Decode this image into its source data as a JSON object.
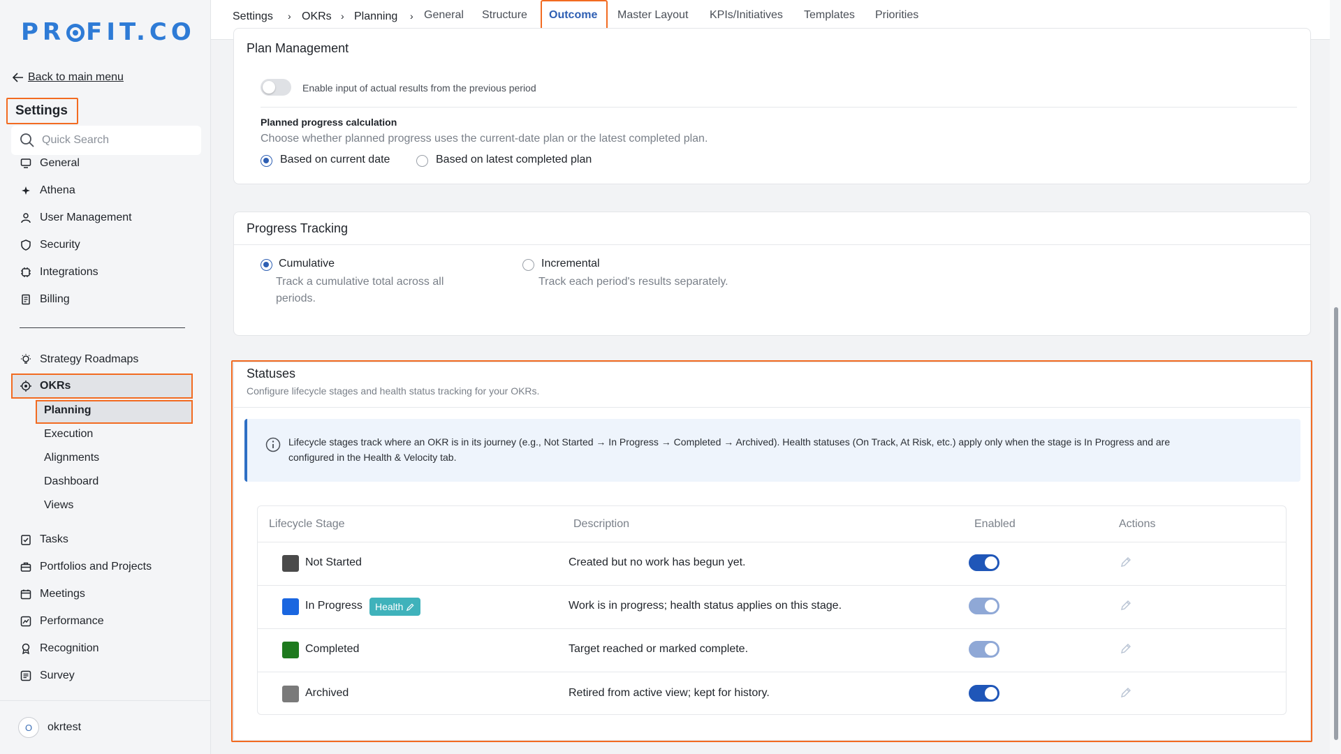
{
  "brand": {
    "logo_text_a": "PR",
    "logo_text_b": "FIT.CO"
  },
  "sidebar": {
    "back_label": "Back to main menu",
    "settings_title": "Settings",
    "search_placeholder": "Quick Search",
    "items": [
      {
        "label": "General",
        "icon": "monitor-icon"
      },
      {
        "label": "Athena",
        "icon": "sparkle-icon"
      },
      {
        "label": "User Management",
        "icon": "user-icon"
      },
      {
        "label": "Security",
        "icon": "shield-icon"
      },
      {
        "label": "Integrations",
        "icon": "chip-icon"
      },
      {
        "label": "Billing",
        "icon": "receipt-icon"
      }
    ],
    "modules": [
      {
        "label": "Strategy Roadmaps",
        "icon": "bulb-icon"
      },
      {
        "label": "OKRs",
        "icon": "target-icon"
      }
    ],
    "okr_children": [
      "Planning",
      "Execution",
      "Alignments",
      "Dashboard",
      "Views"
    ],
    "more_items": [
      {
        "label": "Tasks",
        "icon": "checklist-icon"
      },
      {
        "label": "Portfolios and Projects",
        "icon": "briefcase-icon"
      },
      {
        "label": "Meetings",
        "icon": "calendar-icon"
      },
      {
        "label": "Performance",
        "icon": "chart-icon"
      },
      {
        "label": "Recognition",
        "icon": "award-icon"
      },
      {
        "label": "Survey",
        "icon": "form-icon"
      }
    ],
    "user": {
      "initial": "O",
      "name": "okrtest"
    }
  },
  "topnav": {
    "breadcrumbs": [
      "Settings",
      "OKRs",
      "Planning"
    ],
    "tabs": [
      "General",
      "Structure",
      "Outcome",
      "Master Layout",
      "KPIs/Initiatives",
      "Templates",
      "Priorities"
    ],
    "active_tab": "Outcome"
  },
  "plan_management": {
    "title": "Plan Management",
    "toggle_label": "Enable input of actual results from the previous period",
    "toggle_on": false,
    "calc_title": "Planned progress calculation",
    "calc_desc": "Choose whether planned progress uses the current-date plan or the latest completed plan.",
    "options": [
      "Based on current date",
      "Based on latest completed plan"
    ],
    "selected": 0
  },
  "progress_tracking": {
    "title": "Progress Tracking",
    "options": [
      {
        "label": "Cumulative",
        "desc_line1": "Track a cumulative total across all",
        "desc_line2": "periods."
      },
      {
        "label": "Incremental",
        "desc_line1": "Track each period's results separately."
      }
    ],
    "selected": 0
  },
  "statuses": {
    "title": "Statuses",
    "subtitle": "Configure lifecycle stages and health status tracking for your OKRs.",
    "info_line1": "Lifecycle stages track where an OKR is in its journey (e.g., Not Started → In Progress → Completed → Archived). Health statuses (On Track, At Risk, etc.) apply only when the stage is In Progress and are",
    "info_line2": "configured in the Health & Velocity tab.",
    "columns": [
      "Lifecycle Stage",
      "Description",
      "Enabled",
      "Actions"
    ],
    "rows": [
      {
        "stage": "Not Started",
        "color": "#4a4a4a",
        "description": "Created but no work has begun yet.",
        "enabled": true,
        "locked": false
      },
      {
        "stage": "In Progress",
        "color": "#1a66e0",
        "description": "Work is in progress; health status applies on this stage.",
        "enabled": true,
        "locked": true,
        "badge": "Health"
      },
      {
        "stage": "Completed",
        "color": "#1e7a1e",
        "description": "Target reached or marked complete.",
        "enabled": true,
        "locked": true
      },
      {
        "stage": "Archived",
        "color": "#7a7a7a",
        "description": "Retired from active view; kept for history.",
        "enabled": true,
        "locked": false
      }
    ]
  },
  "colors": {
    "accent": "#2e5fb3",
    "highlight": "#f26b21",
    "toggle_on": "#1f56b8",
    "toggle_locked": "#8fa8d6"
  }
}
